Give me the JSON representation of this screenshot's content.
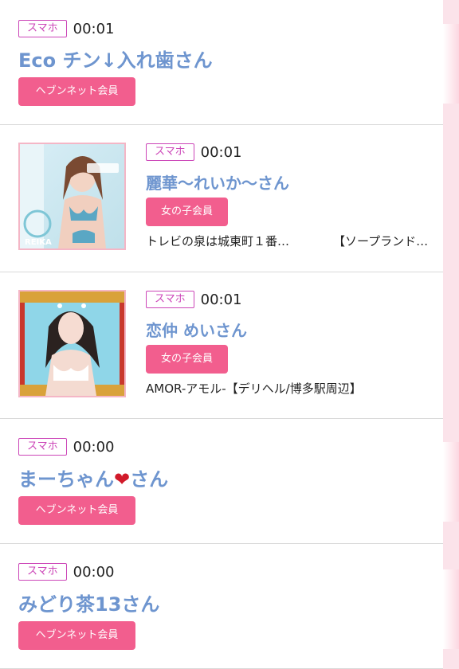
{
  "colors": {
    "name_blue": "#6e95cf",
    "member_pink": "#f25e8e",
    "device_border": "#cc46b8",
    "thumb_border": "#f4b6c6"
  },
  "posts": [
    {
      "device": "スマホ",
      "time": "00:01",
      "name": "Eco チン↓入れ歯さん",
      "member_type": "ヘブンネット会員",
      "has_thumbnail": false
    },
    {
      "device": "スマホ",
      "time": "00:01",
      "name": "麗華〜れいか〜さん",
      "member_type": "女の子会員",
      "shop_area": "トレビの泉は城東町１番…",
      "shop_category": "【ソープランド…",
      "has_thumbnail": true,
      "thumbnail_text": "REIKA"
    },
    {
      "device": "スマホ",
      "time": "00:01",
      "name": "恋仲 めいさん",
      "member_type": "女の子会員",
      "shop": "AMOR-アモル-【デリヘル/博多駅周辺】",
      "has_thumbnail": true
    },
    {
      "device": "スマホ",
      "time": "00:00",
      "name_prefix": "まーちゃん",
      "name_heart": "❤",
      "name_suffix": "さん",
      "member_type": "ヘブンネット会員",
      "has_thumbnail": false
    },
    {
      "device": "スマホ",
      "time": "00:00",
      "name": "みどり茶13さん",
      "member_type": "ヘブンネット会員",
      "has_thumbnail": false
    }
  ]
}
